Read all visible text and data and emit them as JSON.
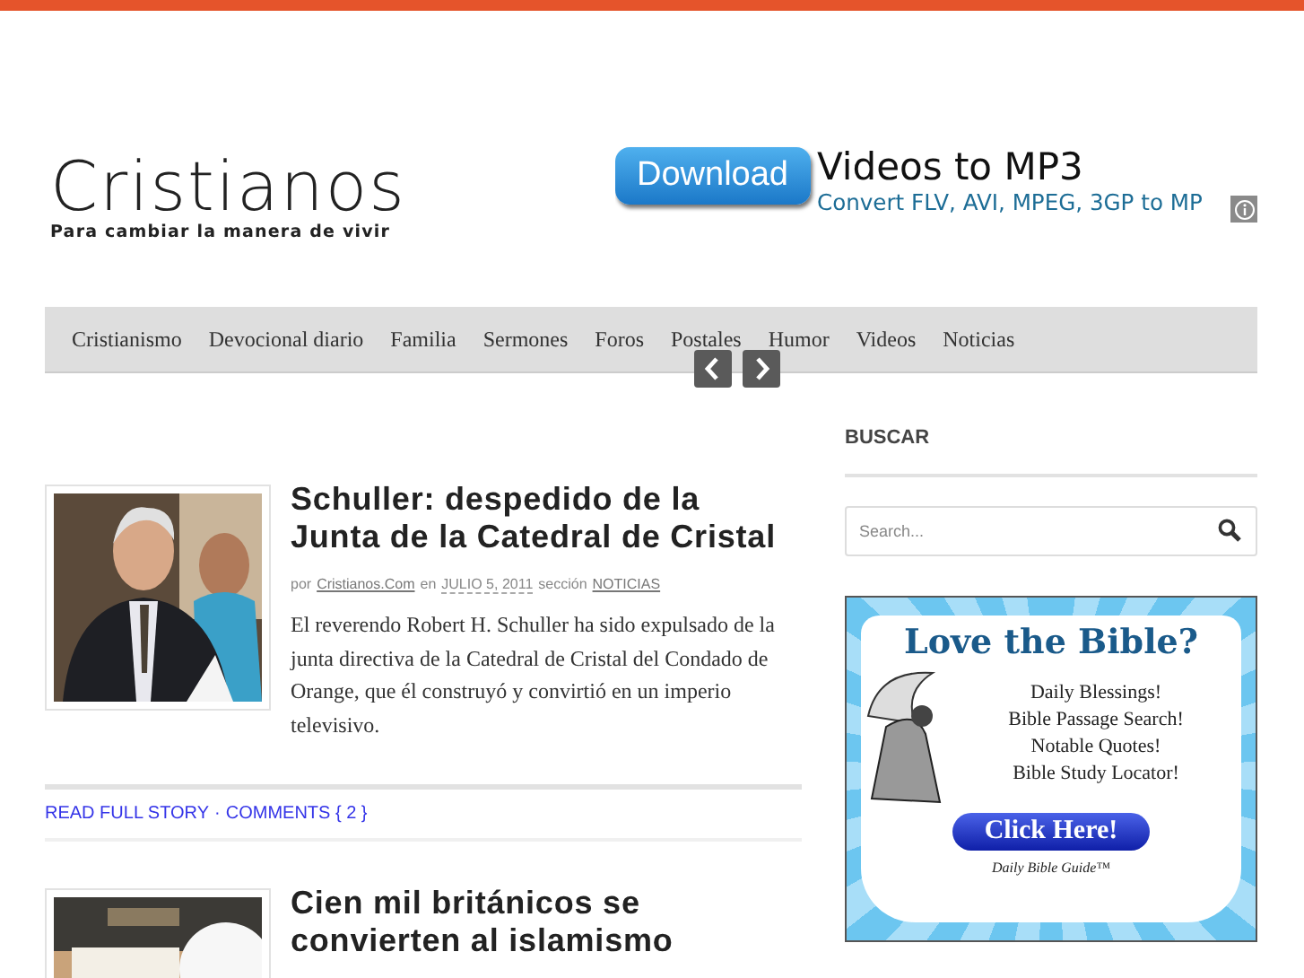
{
  "logo": {
    "title": "Cristianos",
    "tagline": "Para cambiar la manera de vivir"
  },
  "banner_ad": {
    "button": "Download",
    "headline": "Videos to MP3",
    "subline": "Convert FLV, AVI, MPEG, 3GP to MP"
  },
  "nav": {
    "items": [
      "Cristianismo",
      "Devocional diario",
      "Familia",
      "Sermones",
      "Foros",
      "Postales",
      "Humor",
      "Videos",
      "Noticias"
    ]
  },
  "posts": [
    {
      "title": "Schuller: despedido de la Junta de la Catedral de Cristal",
      "byline": {
        "prefix": "por",
        "author": "Cristianos.Com",
        "on": "en",
        "date": "JULIO 5, 2011",
        "section_label": "sección",
        "section": "NOTICIAS"
      },
      "excerpt": "El reverendo Robert H. Schuller ha sido expulsado de la junta directiva de la Catedral de Cristal del Condado de Orange, que él construyó y convirtió en un imperio televisivo.",
      "links": [
        "READ FULL STORY",
        "COMMENTS { 2 }"
      ],
      "separator": "·"
    },
    {
      "title": "Cien mil británicos se convierten al islamismo"
    }
  ],
  "sidebar": {
    "heading": "BUSCAR",
    "search": {
      "placeholder": "Search..."
    },
    "ad": {
      "headline": "Love the Bible?",
      "lines": [
        "Daily Blessings!",
        "Bible Passage Search!",
        "Notable Quotes!",
        "Bible Study Locator!"
      ],
      "button": "Click Here!",
      "brand": "Daily Bible Guide™"
    }
  }
}
